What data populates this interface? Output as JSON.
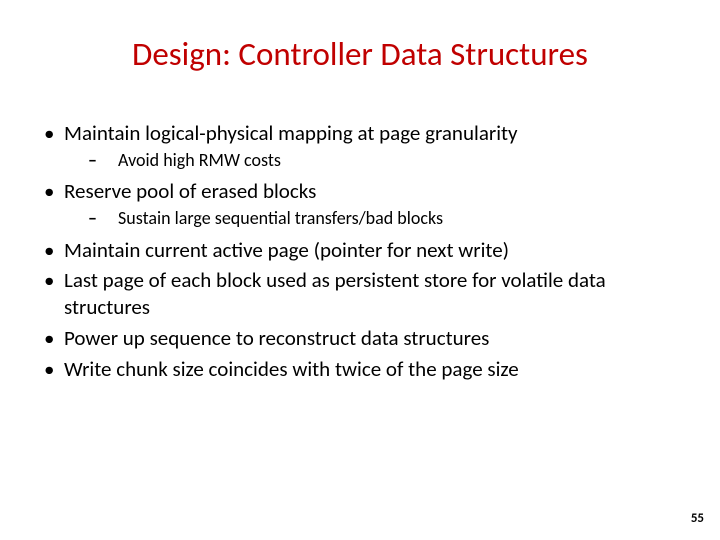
{
  "title": "Design: Controller Data Structures",
  "bullets": {
    "b1": "Maintain logical-physical mapping at page granularity",
    "b1_sub1": "Avoid high RMW costs",
    "b2": "Reserve pool of erased blocks",
    "b2_sub1": "Sustain large sequential transfers/bad blocks",
    "b3": "Maintain current active page (pointer for next write)",
    "b4": "Last page of each block used as persistent store for volatile data structures",
    "b5": "Power up sequence to reconstruct data structures",
    "b6": "Write chunk size coincides with twice of the page size"
  },
  "page_number": "55"
}
